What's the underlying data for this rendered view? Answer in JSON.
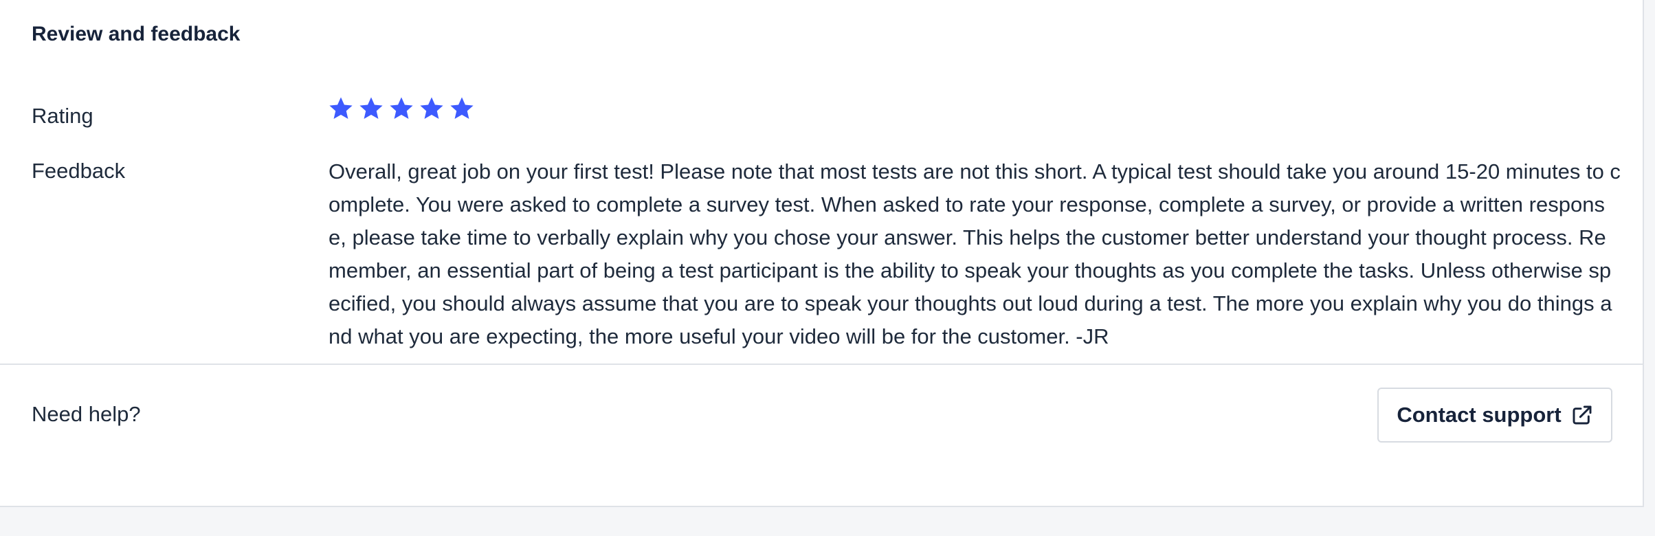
{
  "section": {
    "title": "Review and feedback"
  },
  "rating": {
    "label": "Rating",
    "value": 5,
    "max": 5,
    "star_color": "#3d5afe",
    "icon": "star-icon"
  },
  "feedback": {
    "label": "Feedback",
    "text": "Overall, great job on your first test! Please note that most tests are not this short. A typical test should take you around 15-20 minutes to complete. You were asked to complete a survey test. When asked to rate your response, complete a survey, or provide a written response, please take time to verbally explain why you chose your answer. This helps the customer better understand your thought process. Remember, an essential part of being a test participant is the ability to speak your thoughts as you complete the tasks. Unless otherwise specified, you should always assume that you are to speak your thoughts out loud during a test. The more you explain why you do things and what you are expecting, the more useful your video will be for the customer. -JR"
  },
  "help": {
    "label": "Need help?",
    "contact_button_label": "Contact support",
    "contact_icon": "external-link-icon"
  }
}
